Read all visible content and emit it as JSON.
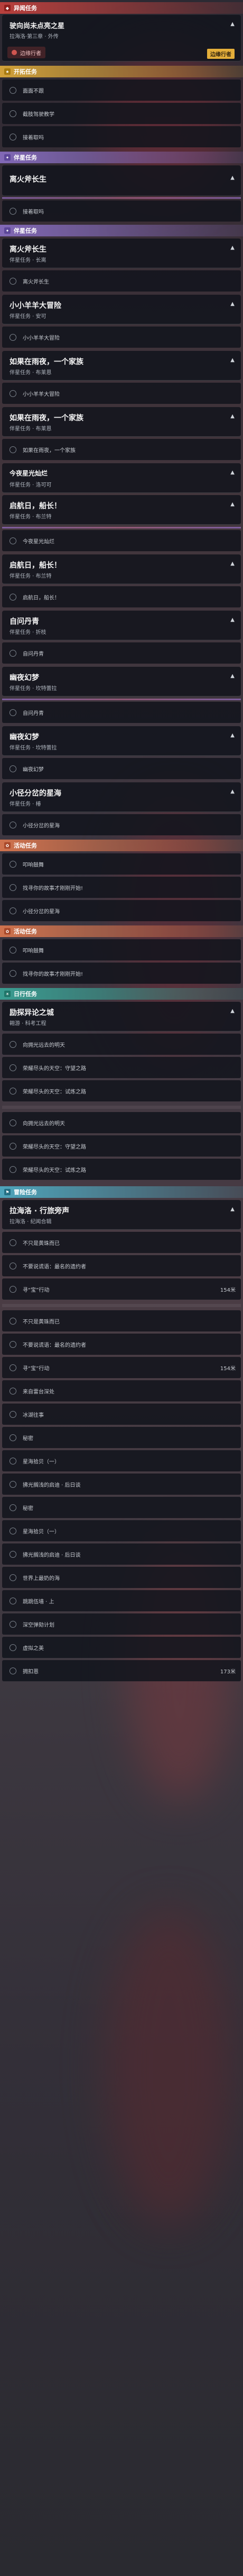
{
  "sections": {
    "anomaly": "异闻任务",
    "trailblaze": "开拓任务",
    "companion": "伴星任务",
    "event": "活动任务",
    "daily": "日行任务",
    "adventure": "冒险任务"
  },
  "top": {
    "title": "驶向尚未点亮之星",
    "sub": "拉海洛·第三章 · 外传",
    "badge": "边缘行者",
    "item": "边缘行者"
  },
  "trailblaze": {
    "rows": [
      "面面不跟",
      "截肢驾驶教学",
      "接着取吗"
    ]
  },
  "qiuhuo": {
    "title": "离火斧长生",
    "row": "接着取吗"
  },
  "companion": {
    "c1": {
      "title": "离火斧长生",
      "sub": "伴星任务 · 长离",
      "row": "离火斧长生"
    },
    "c2": {
      "title": "小小羊羊大冒险",
      "sub": "伴星任务 · 安可",
      "row": "小小羊羊大冒险"
    },
    "c3": {
      "title": "如果在雨夜，一个家族",
      "sub": "伴星任务 · 布莱恩",
      "row": "小小羊羊大冒险"
    },
    "c4": {
      "title": "如果在雨夜，一个家族",
      "sub": "伴星任务 · 布莱恩",
      "row": "如果在雨夜，一个家族"
    },
    "c5": {
      "title": "今夜星光灿烂",
      "sub": "伴星任务 · 洛可可"
    },
    "c6": {
      "title": "启航日，船长！",
      "sub": "伴星任务 · 布兰特",
      "row": "今夜星光灿烂"
    },
    "c7": {
      "title": "启航日，船长！",
      "sub": "伴星任务 · 布兰特",
      "row": "启航日，船长！"
    },
    "c8": {
      "title": "自问丹青",
      "sub": "伴星任务 · 折枝",
      "row": "自问丹青"
    },
    "c9": {
      "title": "幽夜幻梦",
      "sub": "伴星任务 · 坎特蕾拉",
      "row": "自问丹青"
    },
    "c10": {
      "title": "幽夜幻梦",
      "sub": "伴星任务 · 坎特蕾拉",
      "row": "幽夜幻梦"
    },
    "c11": {
      "title": "小径分岔的星海",
      "sub": "伴星任务 · 椿",
      "row": "小径分岔的星海"
    }
  },
  "event1": {
    "rows": [
      "叩响鼓舞",
      "找寻你的故事才刚刚开始!",
      "小径分岔的星海"
    ]
  },
  "event2": {
    "rows": [
      "叩响鼓舞",
      "找寻你的故事才刚刚开始!"
    ]
  },
  "daily": {
    "title": "励探异论之城",
    "sub": "翱游 · 科考工程",
    "rows": [
      "向拥光远去的明天",
      "荣耀尽头的天空：守望之路",
      "荣耀尽头的天空：试炼之路"
    ],
    "rows2": [
      "向拥光远去的明天",
      "荣耀尽头的天空：守望之路",
      "荣耀尽头的天空：试炼之路"
    ]
  },
  "adventure": {
    "title": "拉海洛 · 行旅旁声",
    "sub": "拉海洛 · 纪闻合辑",
    "rows": [
      {
        "t": "不只是黄珠而已",
        "n": ""
      },
      {
        "t": "不要说谎语：最名的遗约者",
        "n": ""
      },
      {
        "t": "寻“宝”行动",
        "n": "154米"
      }
    ],
    "rows2": [
      {
        "t": "不只是黄珠而已",
        "n": ""
      },
      {
        "t": "不要说谎语：最名的遗约者",
        "n": ""
      },
      {
        "t": "寻“宝”行动",
        "n": "154米"
      },
      {
        "t": "来自雷台深处",
        "n": ""
      },
      {
        "t": "冰湖往事",
        "n": ""
      },
      {
        "t": "秘密",
        "n": ""
      },
      {
        "t": "星海拾贝（一）",
        "n": ""
      },
      {
        "t": "拂光搁浅的启迪 · 后日谈",
        "n": ""
      },
      {
        "t": "秘密",
        "n": ""
      },
      {
        "t": "星海拾贝（一）",
        "n": ""
      },
      {
        "t": "拂光搁浅的启迪 · 后日谈",
        "n": ""
      },
      {
        "t": "世界上最奶的海",
        "n": ""
      },
      {
        "t": "跳跳伍墙 · 上",
        "n": ""
      },
      {
        "t": "深空弹劾计划",
        "n": ""
      },
      {
        "t": "虚拟之美",
        "n": ""
      },
      {
        "t": "拥扣恩",
        "n": "173米"
      }
    ]
  },
  "colors": {
    "anomaly": "#c8423e",
    "trailblaze": "#e4ae3a",
    "companion": "#8a6fc4",
    "event": "#e0794f",
    "daily": "#3aa89a",
    "adventure": "#4fb0c8"
  }
}
